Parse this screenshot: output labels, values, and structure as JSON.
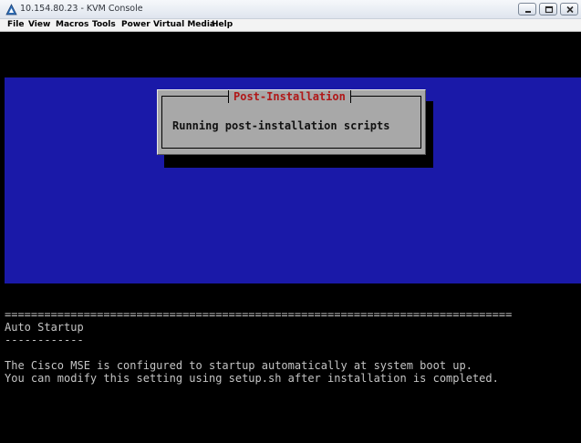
{
  "window": {
    "title": "10.154.80.23 - KVM Console",
    "icon": "kvm-app-icon",
    "controls": {
      "minimize_icon": "minimize-icon",
      "maximize_icon": "maximize-icon",
      "close_icon": "close-icon"
    }
  },
  "menu": {
    "items": [
      "File",
      "View",
      "Macros",
      "Tools",
      "Power",
      "Virtual Media",
      "Help"
    ]
  },
  "console": {
    "colors": {
      "background": "#000000",
      "band": "#1a19a8",
      "dialog": "#a8a8a8",
      "dialog_title": "#b01818",
      "text": "#c4c4c4"
    },
    "dialog": {
      "title": "Post-Installation",
      "message": "Running post-installation scripts"
    },
    "lines": {
      "separator": "=============================================================================",
      "heading": "Auto Startup",
      "underline": "------------",
      "message_1": "The Cisco MSE is configured to startup automatically at system boot up.",
      "message_2": "You can modify this setting using setup.sh after installation is completed."
    }
  }
}
